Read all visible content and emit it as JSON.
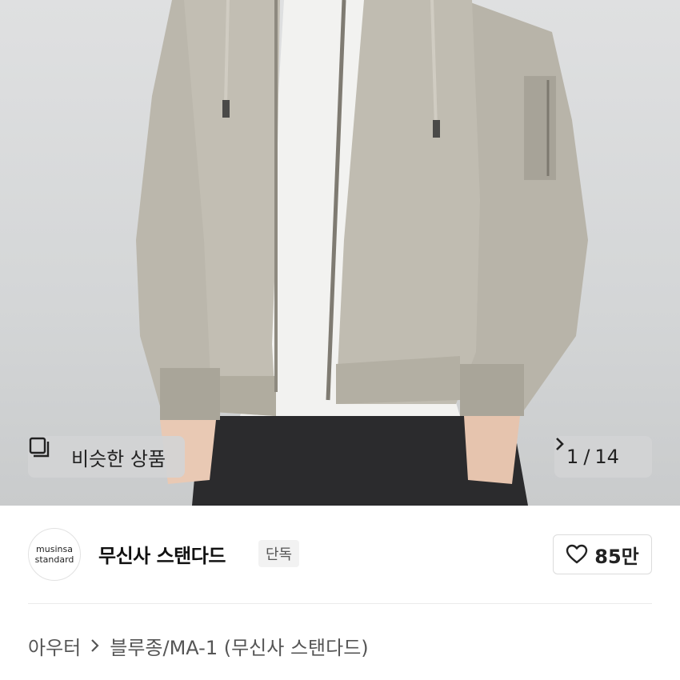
{
  "hero": {
    "similar_label": "비슷한 상품",
    "counter_current": "1",
    "counter_separator": "/",
    "counter_total": "14"
  },
  "brand": {
    "logo_line1": "musinsa",
    "logo_line2": "standard",
    "name": "무신사 스탠다드",
    "badge": "단독",
    "like_count": "85만"
  },
  "breadcrumb": {
    "category": "아우터",
    "subcategory": "블루종/MA-1 (무신사 스탠다드)"
  },
  "colors": {
    "jacket": "#b9b5aa",
    "background": "#d8d9da"
  },
  "icons": {
    "similar": "similar-products-icon",
    "next": "chevron-right-icon",
    "like": "heart-icon",
    "crumb": "chevron-right-icon"
  }
}
